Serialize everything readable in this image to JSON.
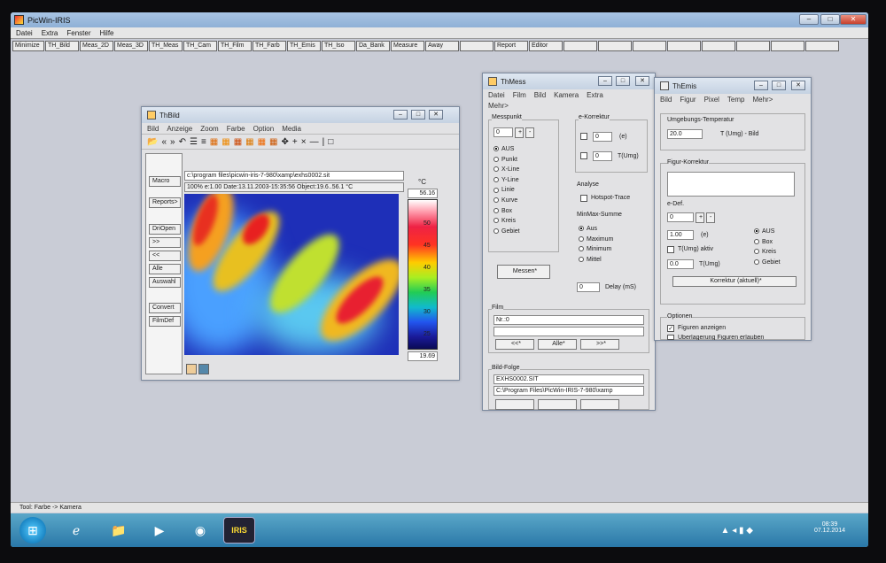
{
  "app": {
    "title": "PicWin-IRIS"
  },
  "menubar": [
    "Datei",
    "Extra",
    "Fenster",
    "Hilfe"
  ],
  "toolbar": [
    "Minimize",
    "TH_Bild",
    "Meas_2D",
    "Meas_3D",
    "TH_Meas",
    "TH_Cam",
    "TH_Film",
    "TH_Farb",
    "TH_Emis",
    "TH_Iso",
    "Da_Bank",
    "Measure",
    "Away",
    "",
    "Report",
    "Editor"
  ],
  "thbild": {
    "title": "ThBild",
    "menu": [
      "Bild",
      "Anzeige",
      "Zoom",
      "Farbe",
      "Option",
      "Media"
    ],
    "left_buttons": [
      "Macro",
      "Reports>",
      "DriOpen",
      ">>",
      "<<",
      "Alle",
      "Auswahl",
      "Convert",
      "FilmDef"
    ],
    "path": "c:\\program files\\picwin-iris-7-980\\xamp\\exhs0002.sit",
    "info": "100%   e:1.00   Date:13.11.2003-15:35:56   Object:19.6..56.1 °C",
    "scale_unit": "°C",
    "scale_max": "56.16",
    "scale_min": "19.69",
    "scale_ticks": [
      "50",
      "45",
      "40",
      "35",
      "30",
      "25"
    ]
  },
  "thmess": {
    "title": "ThMess",
    "menu": [
      "Datei",
      "Film",
      "Bild",
      "Kamera",
      "Extra"
    ],
    "menu2": "Mehr>",
    "messpunkt_label": "Messpunkt",
    "messpunkt_value": "0",
    "options": [
      "AUS",
      "Punkt",
      "X-Line",
      "Y-Line",
      "Linie",
      "Kurve",
      "Box",
      "Kreis",
      "Gebiet"
    ],
    "ekorrektur_label": "e-Korrektur",
    "ek_field1": "0",
    "ek_unit1": "(e)",
    "ek_field2": "0",
    "ek_unit2": "T(Umg)",
    "analyse_label": "Analyse",
    "hotspot": "Hotspot-Trace",
    "minmax_label": "MinMax-Summe",
    "minmax_options": [
      "Aus",
      "Maximum",
      "Minimum",
      "Mittel"
    ],
    "messen": "Messen*",
    "delay_value": "0",
    "delay_label": "Delay (mS)",
    "film_label": "Film",
    "film_nr": "Nr.:0",
    "film_buttons": [
      "<<*",
      "Alle*",
      ">>*"
    ],
    "bildfolge_label": "Bild-Folge",
    "bildfolge_name": "EXHS0002.SIT",
    "bildfolge_path": "C:\\Program Files\\PicWin-IRIS-7-980\\xamp"
  },
  "themis": {
    "title": "ThEmis",
    "menu": [
      "Bild",
      "Figur",
      "Pixel",
      "Temp",
      "Mehr>"
    ],
    "umgebung_label": "Umgebungs-Temperatur",
    "umgebung_value": "20.0",
    "umgebung_unit": "T (Umg) - Bild",
    "figur_label": "Figur-Korrektur",
    "edef_label": "e-Def.",
    "edef_value": "0",
    "e_value": "1.00",
    "e_unit": "(e)",
    "tumg_aktiv": "T(Umg) aktiv",
    "tumg_value": "0.0",
    "tumg_unit": "T(Umg)",
    "radios": [
      "AUS",
      "Box",
      "Kreis",
      "Gebiet"
    ],
    "korrektur_btn": "Korrektur (aktuell)*",
    "optionen_label": "Optionen",
    "fig_anzeigen": "Figuren anzeigen",
    "fig_cut": "Überlagerung Figuren erlauben"
  },
  "status": "Tool: Farbe -> Kamera",
  "clock": {
    "time": "08:39",
    "date": "07.12.2014"
  },
  "taskbar": {
    "iris_label": "IRIS"
  }
}
